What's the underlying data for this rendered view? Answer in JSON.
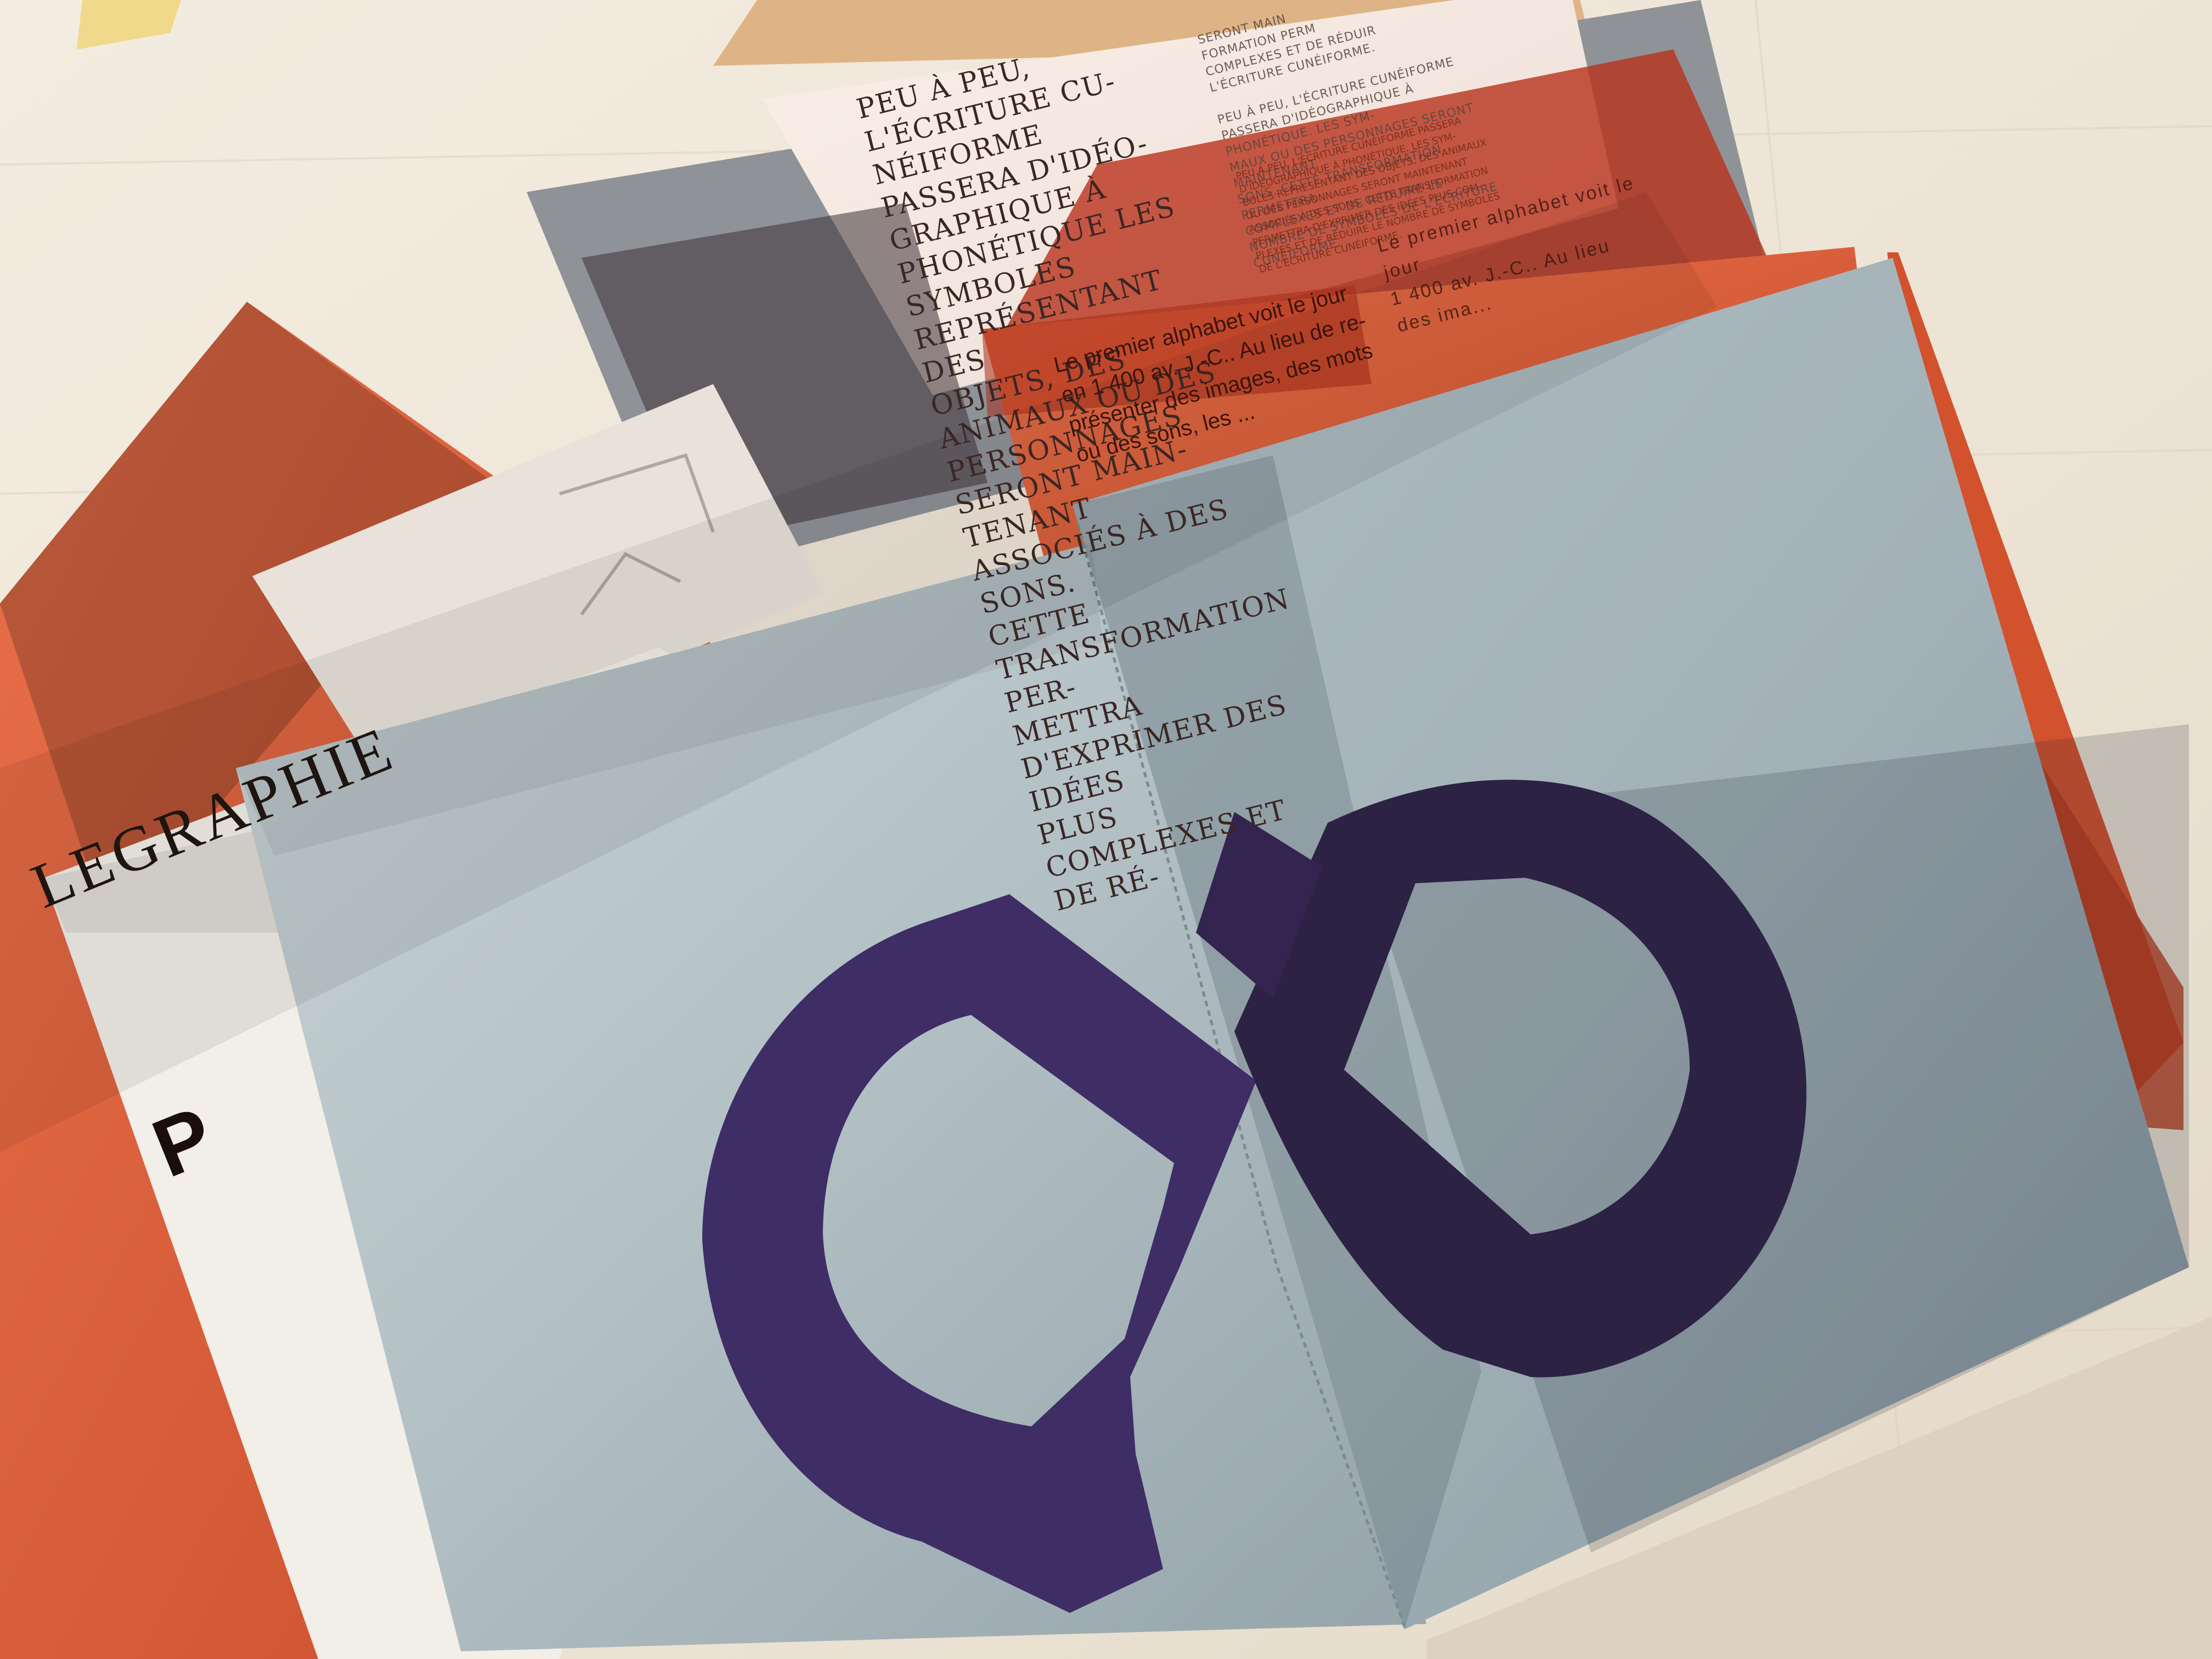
{
  "scene": {
    "colors": {
      "table": "#efe6d8",
      "orange_paper": "#e0623a",
      "gray_blue_paper": "#b4c2c6",
      "white_paper": "#f1ede6",
      "glyph_purple": "#3b2a60"
    },
    "icons": [
      "infinity-glyph-icon"
    ]
  },
  "texts": {
    "top_page_large": "PEU À PEU, L'ÉCRITURE CU-\nNÉIFORME PASSERA D'IDÉO-\nGRAPHIQUE À PHONÉTIQUE LES\nSYMBOLES REPRÉSENTANT DES\nOBJETS, DES ANIMAUX OU DES\nPERSONNAGES SERONT MAIN-\nTENANT ASSOCIÉS À DES SONS.\nCETTE TRANSFORMATION PER-\nMETTRA D'EXPRIMER DES IDÉES\nPLUS COMPLEXES ET DE RÉ-",
    "top_page_small": "SERONT MAIN\nFORMATION PERM\nCOMPLEXES ET DE RÉDUIR\nL'ÉCRITURE CUNÉIFORME.\n\nPEU À PEU, L'ÉCRITURE CUNÉIFORME PASSERA D'IDÉOGRAPHIQUE À PHONÉTIQUE. LES SYM-\nMAUX OU DES PERSONNAGES SERONT MAINTENANT\nSONS. CETTE TRANSFORMATION PERMETTRA\nCOMPLEXES ET DE RÉDUIRE LE NOMBRE DE SYMBOLES DE L'ÉCRITURE\nCUNÉIFORME.",
    "top_page_small_2": "PEU À PEU, L'ÉCRITURE CUNÉIFORME PASSERA D'IDÉOGRAPHIQUE À PHONÉTIQUE. LES SYM-\nBOLES REPRÉSENTANT DES OBJETS, DES ANIMAUX OU DES PERSONNAGES SERONT MAINTENANT\nASSOCIÉS À DES SONS. CETTE TRANSFORMATION PERMETTRA D'EXPRIMER DES IDÉES PLUS COM-\nPLEXES ET DE RÉDUIRE LE NOMBRE DE SYMBOLES DE L'ÉCRITURE CUNÉIFORME.",
    "orange_sheet_text": "Le premier alphabet voit le jour\nen 1 400 av. J.-C.. Au lieu de re-\nprésenter des images, des mots\nou des sons, les ...",
    "orange_sheet_text_2": "Le premier alphabet voit le jour\n1 400 av. J.-C.. Au lieu\ndes ima...",
    "left_cover_title": "LEGRAPHIE",
    "left_cover_letter": "P"
  }
}
